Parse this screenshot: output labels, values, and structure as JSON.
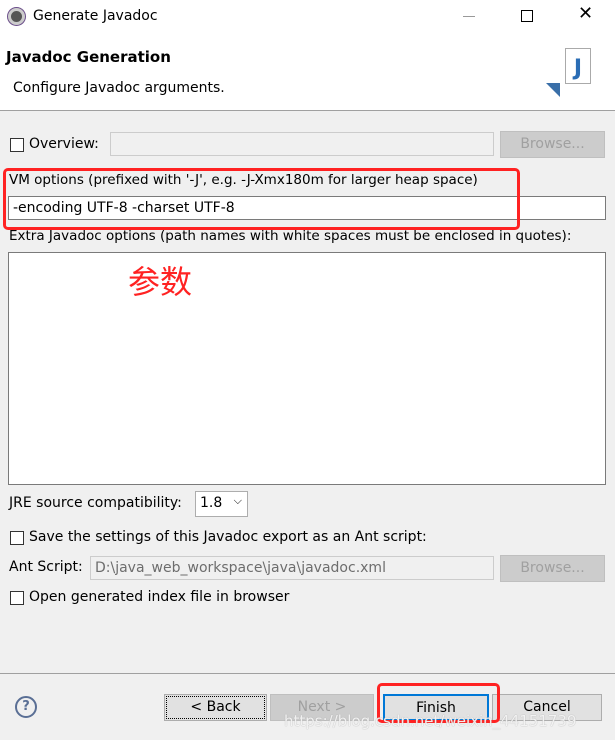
{
  "window": {
    "title": "Generate Javadoc"
  },
  "header": {
    "title": "Javadoc Generation",
    "subtitle": "Configure Javadoc arguments."
  },
  "overview": {
    "label": "Overview:",
    "value": "",
    "browse": "Browse..."
  },
  "vm": {
    "label": "VM options (prefixed with '-J', e.g. -J-Xmx180m for larger heap space)",
    "value": "-encoding UTF-8 -charset UTF-8"
  },
  "extra": {
    "label": "Extra Javadoc options (path names with white spaces must be enclosed in quotes):",
    "value": ""
  },
  "annotation": "参数",
  "jre": {
    "label": "JRE source compatibility:",
    "value": "1.8"
  },
  "save": {
    "label": "Save the settings of this Javadoc export as an Ant script:"
  },
  "ant": {
    "label": "Ant Script:",
    "value": "D:\\java_web_workspace\\java\\javadoc.xml",
    "browse": "Browse..."
  },
  "open": {
    "label": "Open generated index file in browser"
  },
  "buttons": {
    "back": "< Back",
    "next": "Next >",
    "finish": "Finish",
    "cancel": "Cancel"
  },
  "watermark": "https://blog.csdn.net/weixin_44151739"
}
